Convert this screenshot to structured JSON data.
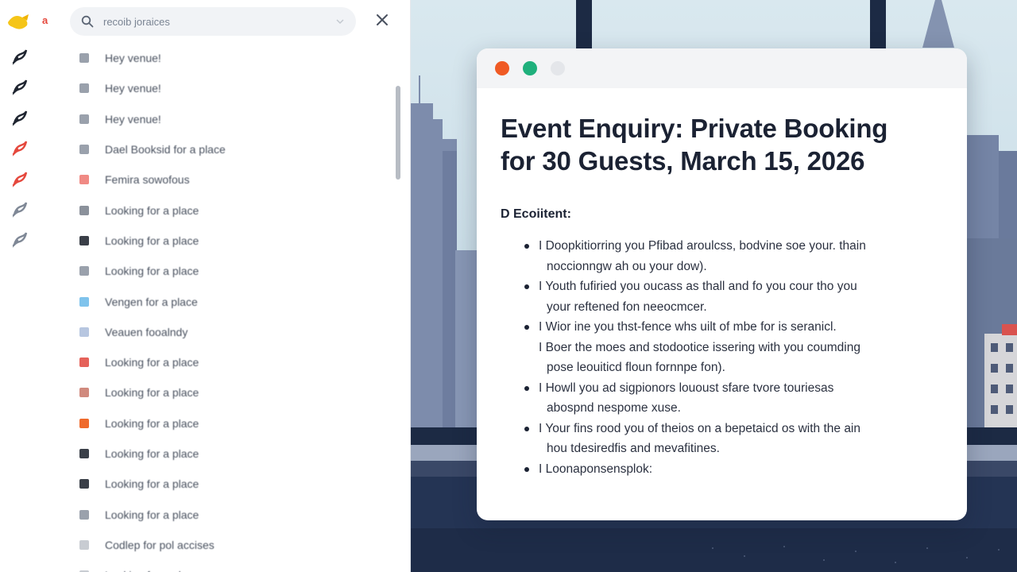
{
  "app": {
    "logo_letter": "a",
    "rail_icons": [
      {
        "icon": "feather-icon",
        "color": "#1f2530"
      },
      {
        "icon": "feather-icon",
        "color": "#1f2530"
      },
      {
        "icon": "feather-icon",
        "color": "#1f2530"
      },
      {
        "icon": "feather-icon",
        "color": "#e5483d"
      },
      {
        "icon": "feather-icon",
        "color": "#e5483d"
      },
      {
        "icon": "feather-icon",
        "color": "#7f8896"
      },
      {
        "icon": "feather-icon",
        "color": "#7f8896"
      }
    ]
  },
  "search": {
    "text": "recoib joraices",
    "icon": "search-icon"
  },
  "mail_list": [
    {
      "subject": "Hey venue!",
      "icon_color": "#9aa1ac"
    },
    {
      "subject": "Hey venue!",
      "icon_color": "#9aa1ac"
    },
    {
      "subject": "Hey venue!",
      "icon_color": "#9aa1ac"
    },
    {
      "subject": "Dael Booksid for a place",
      "icon_color": "#9aa1ac"
    },
    {
      "subject": "Femira sowofous",
      "icon_color": "#f08a84"
    },
    {
      "subject": "Looking for a place",
      "icon_color": "#8b919b"
    },
    {
      "subject": "Looking for a place",
      "icon_color": "#3a3f48"
    },
    {
      "subject": "Looking for a place",
      "icon_color": "#9aa1ac"
    },
    {
      "subject": "Vengen for a place",
      "icon_color": "#7fc3ec"
    },
    {
      "subject": "Veauen fooalndy",
      "icon_color": "#b7c6e0"
    },
    {
      "subject": "Looking for a place",
      "icon_color": "#e5625a"
    },
    {
      "subject": "Looking for a place",
      "icon_color": "#d08a7e"
    },
    {
      "subject": "Looking for a place",
      "icon_color": "#ef6a2c"
    },
    {
      "subject": "Looking for a place",
      "icon_color": "#3a3f48"
    },
    {
      "subject": "Looking for a place",
      "icon_color": "#3a3f48"
    },
    {
      "subject": "Looking for a place",
      "icon_color": "#9aa1ac"
    },
    {
      "subject": "Codlep for pol accises",
      "icon_color": "#c8ccd2"
    },
    {
      "subject": "Looking for a place",
      "icon_color": "#c8ccd2"
    }
  ],
  "document": {
    "title": "Event Enquiry: Private Booking for 30 Guests, March 15, 2026",
    "subheading": "D Ecoiitent:",
    "items": [
      {
        "bullet": true,
        "line1": "I Doopkitiorring you Pfibad aroulcss, bodvine soe your. thain",
        "line2": "noccionngw ah ou your dow)."
      },
      {
        "bullet": true,
        "line1": "I Youth fufiried you oucass as thall and fo you cour tho you",
        "line2": "your reftened fon neeocmcer."
      },
      {
        "bullet": true,
        "line1": "I Wior ine you thst-fence whs uilt of mbe for is seranicl.",
        "line2": ""
      },
      {
        "bullet": false,
        "line1": "I Boer the moes and stodootice issering with you coumding",
        "line2": "pose leouiticd floun fornnpe fon)."
      },
      {
        "bullet": true,
        "line1": "I Howll you ad sigpionors lououst sfare tvore touriesas",
        "line2": "abospnd nespome xuse."
      },
      {
        "bullet": true,
        "line1": "I Your fins rood you of theios on a bepetaicd os with the ain",
        "line2": "hou tdesiredfis and mevafitines."
      },
      {
        "bullet": true,
        "line1": "I Loonaponsensplok:",
        "line2": ""
      }
    ]
  },
  "colors": {
    "close_dot": "#ef5a24",
    "minimize_dot": "#1fb07c",
    "maximize_dot": "#e4e6ea",
    "logo": "#f5c518"
  }
}
